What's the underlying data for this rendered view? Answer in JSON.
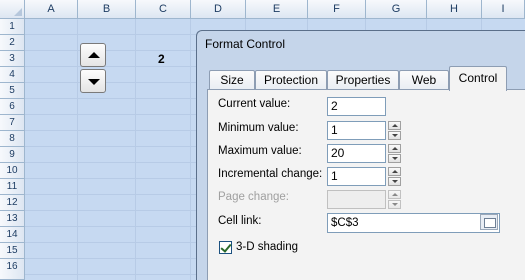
{
  "spreadsheet": {
    "columns": [
      "A",
      "B",
      "C",
      "D",
      "E",
      "F",
      "G",
      "H",
      "I"
    ],
    "rows": [
      "1",
      "2",
      "3",
      "4",
      "5",
      "6",
      "7",
      "8",
      "9",
      "10",
      "11",
      "12",
      "13",
      "14",
      "15",
      "16"
    ],
    "cell_c3_value": "2"
  },
  "dialog": {
    "title": "Format Control",
    "tabs": [
      {
        "label": "Size"
      },
      {
        "label": "Protection"
      },
      {
        "label": "Properties"
      },
      {
        "label": "Web"
      },
      {
        "label": "Control",
        "active": true
      }
    ],
    "fields": {
      "current_value": {
        "label": "Current value:",
        "value": "2"
      },
      "minimum_value": {
        "label": "Minimum value:",
        "value": "1"
      },
      "maximum_value": {
        "label": "Maximum value:",
        "value": "20"
      },
      "incremental_change": {
        "label": "Incremental change:",
        "value": "1"
      },
      "page_change": {
        "label": "Page change:",
        "value": ""
      },
      "cell_link": {
        "label": "Cell link:",
        "value": "$C$3"
      }
    },
    "shading_label": "3-D shading",
    "shading_checked": true
  },
  "colors": {
    "sheet_background": "#c6d9f1",
    "dialog_background": "#c5d5ea",
    "panel_background": "#f3f3f3"
  }
}
